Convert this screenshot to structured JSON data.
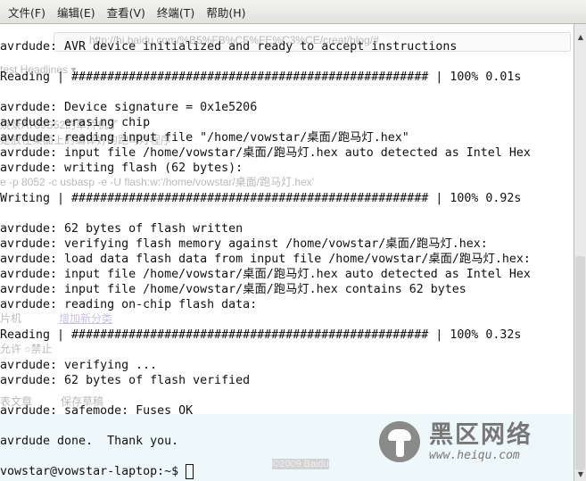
{
  "menu": [
    "文件(F)",
    "编辑(E)",
    "查看(V)",
    "终端(T)",
    "帮助(H)"
  ],
  "background_window": {
    "url": "http://hi.baidu.com/%B5%FB%CF%FE%C3%CE/creat/blog/#",
    "headlines": "test Headlines ▾",
    "text1": "烧录AT89S52的单片机了",
    "text2": "是放在桌面上的编译好的跑马灯程序",
    "command": "e -p 8052 -c usbasp -e -U flash:w:'/home/vowstar/桌面/跑马灯.hex'",
    "category": "片机",
    "add_category": "增加新分类",
    "radio": "允许  ○禁止",
    "publish": "表文章",
    "save_draft": "保存草稿",
    "copyright": "©2009 Baidu"
  },
  "terminal": {
    "lines": [
      "avrdude: AVR device initialized and ready to accept instructions",
      "",
      "Reading | ################################################## | 100% 0.01s",
      "",
      "avrdude: Device signature = 0x1e5206",
      "avrdude: erasing chip",
      "avrdude: reading input file \"/home/vowstar/桌面/跑马灯.hex\"",
      "avrdude: input file /home/vowstar/桌面/跑马灯.hex auto detected as Intel Hex",
      "avrdude: writing flash (62 bytes):",
      "",
      "Writing | ################################################## | 100% 0.92s",
      "",
      "avrdude: 62 bytes of flash written",
      "avrdude: verifying flash memory against /home/vowstar/桌面/跑马灯.hex:",
      "avrdude: load data flash data from input file /home/vowstar/桌面/跑马灯.hex:",
      "avrdude: input file /home/vowstar/桌面/跑马灯.hex auto detected as Intel Hex",
      "avrdude: input file /home/vowstar/桌面/跑马灯.hex contains 62 bytes",
      "avrdude: reading on-chip flash data:",
      "",
      "Reading | ################################################## | 100% 0.32s",
      "",
      "avrdude: verifying ...",
      "avrdude: 62 bytes of flash verified",
      "",
      "avrdude: safemode: Fuses OK",
      "",
      "avrdude done.  Thank you.",
      ""
    ],
    "prompt": "vowstar@vowstar-laptop:~$ "
  },
  "watermark": {
    "name": "黑区网络",
    "url": "www.heiqu.com"
  }
}
